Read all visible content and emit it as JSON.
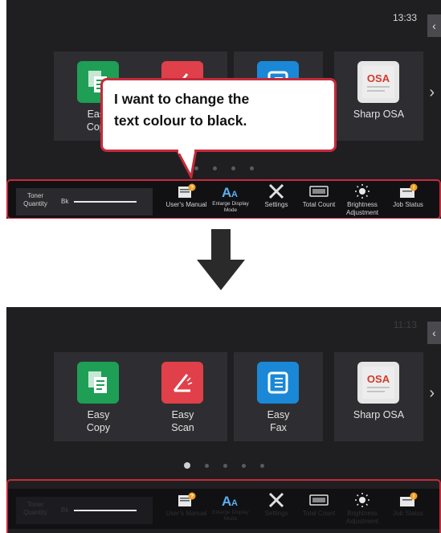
{
  "top_screen": {
    "clock": "13:33",
    "side_tab_glyph": "‹",
    "next_glyph": "›",
    "tiles": [
      {
        "line1": "Easy",
        "line2": "Copy",
        "icon": "easy-copy-icon"
      },
      {
        "line1": "",
        "line2": "",
        "icon": "easy-scan-icon"
      },
      {
        "line1": "",
        "line2": "",
        "icon": "easy-fax-icon"
      },
      {
        "line1": "Sharp OSA",
        "line2": "",
        "icon": "sharp-osa-icon"
      }
    ],
    "callout": {
      "line1": "I want to change the",
      "line2": "text colour to black."
    },
    "dots_count": 4,
    "active_dot": -1,
    "taskbar": {
      "toner_label": "Toner Quantity",
      "toner_color": "Bk",
      "items": [
        {
          "label": "User's Manual",
          "icon": "users-manual-icon"
        },
        {
          "label": "Enlarge Display Mode",
          "icon": "enlarge-display-icon"
        },
        {
          "label": "Settings",
          "icon": "settings-icon"
        },
        {
          "label": "Total Count",
          "icon": "total-count-icon"
        },
        {
          "label": "Brightness Adjustment",
          "icon": "brightness-icon"
        },
        {
          "label": "Job Status",
          "icon": "job-status-icon"
        }
      ]
    }
  },
  "bottom_screen": {
    "clock": "11:13",
    "side_tab_glyph": "‹",
    "next_glyph": "›",
    "tiles": [
      {
        "line1": "Easy",
        "line2": "Copy",
        "icon": "easy-copy-icon"
      },
      {
        "line1": "Easy",
        "line2": "Scan",
        "icon": "easy-scan-icon"
      },
      {
        "line1": "Easy",
        "line2": "Fax",
        "icon": "easy-fax-icon"
      },
      {
        "line1": "Sharp OSA",
        "line2": "",
        "icon": "sharp-osa-icon"
      }
    ],
    "dots_count": 5,
    "active_dot": 0,
    "taskbar": {
      "toner_label": "Toner Quantity",
      "toner_color": "Bk",
      "items": [
        {
          "label": "User's Manual",
          "icon": "users-manual-icon"
        },
        {
          "label": "Enlarge Display Mode",
          "icon": "enlarge-display-icon"
        },
        {
          "label": "Settings",
          "icon": "settings-icon"
        },
        {
          "label": "Total Count",
          "icon": "total-count-icon"
        },
        {
          "label": "Brightness Adjustment",
          "icon": "brightness-icon"
        },
        {
          "label": "Job Status",
          "icon": "job-status-icon"
        }
      ]
    }
  },
  "colors": {
    "highlight": "#c62a3b",
    "copy_green": "#1f9e55",
    "scan_red": "#e0404a",
    "fax_blue": "#1a88d6"
  }
}
